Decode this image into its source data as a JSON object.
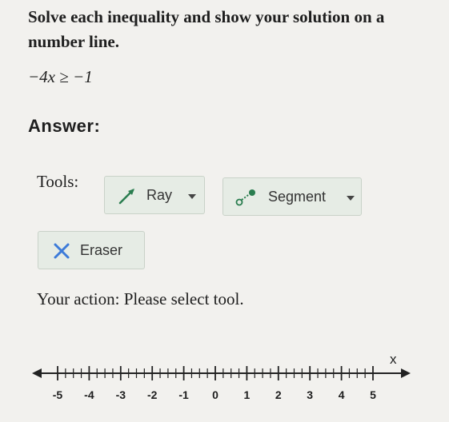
{
  "problem": {
    "instructions": "Solve each inequality and show your solution on a number line.",
    "inequality": "−4x ≥ −1"
  },
  "answer": {
    "heading": "Answer:"
  },
  "tools": {
    "label": "Tools:",
    "ray_label": "Ray",
    "segment_label": "Segment",
    "eraser_label": "Eraser"
  },
  "status": {
    "text": "Your action: Please select tool."
  },
  "number_line": {
    "variable": "x",
    "min": -5,
    "max": 5,
    "minor_step": 0.25,
    "tick_labels": [
      "-5",
      "-4",
      "-3",
      "-2",
      "-1",
      "0",
      "1",
      "2",
      "3",
      "4",
      "5"
    ]
  }
}
